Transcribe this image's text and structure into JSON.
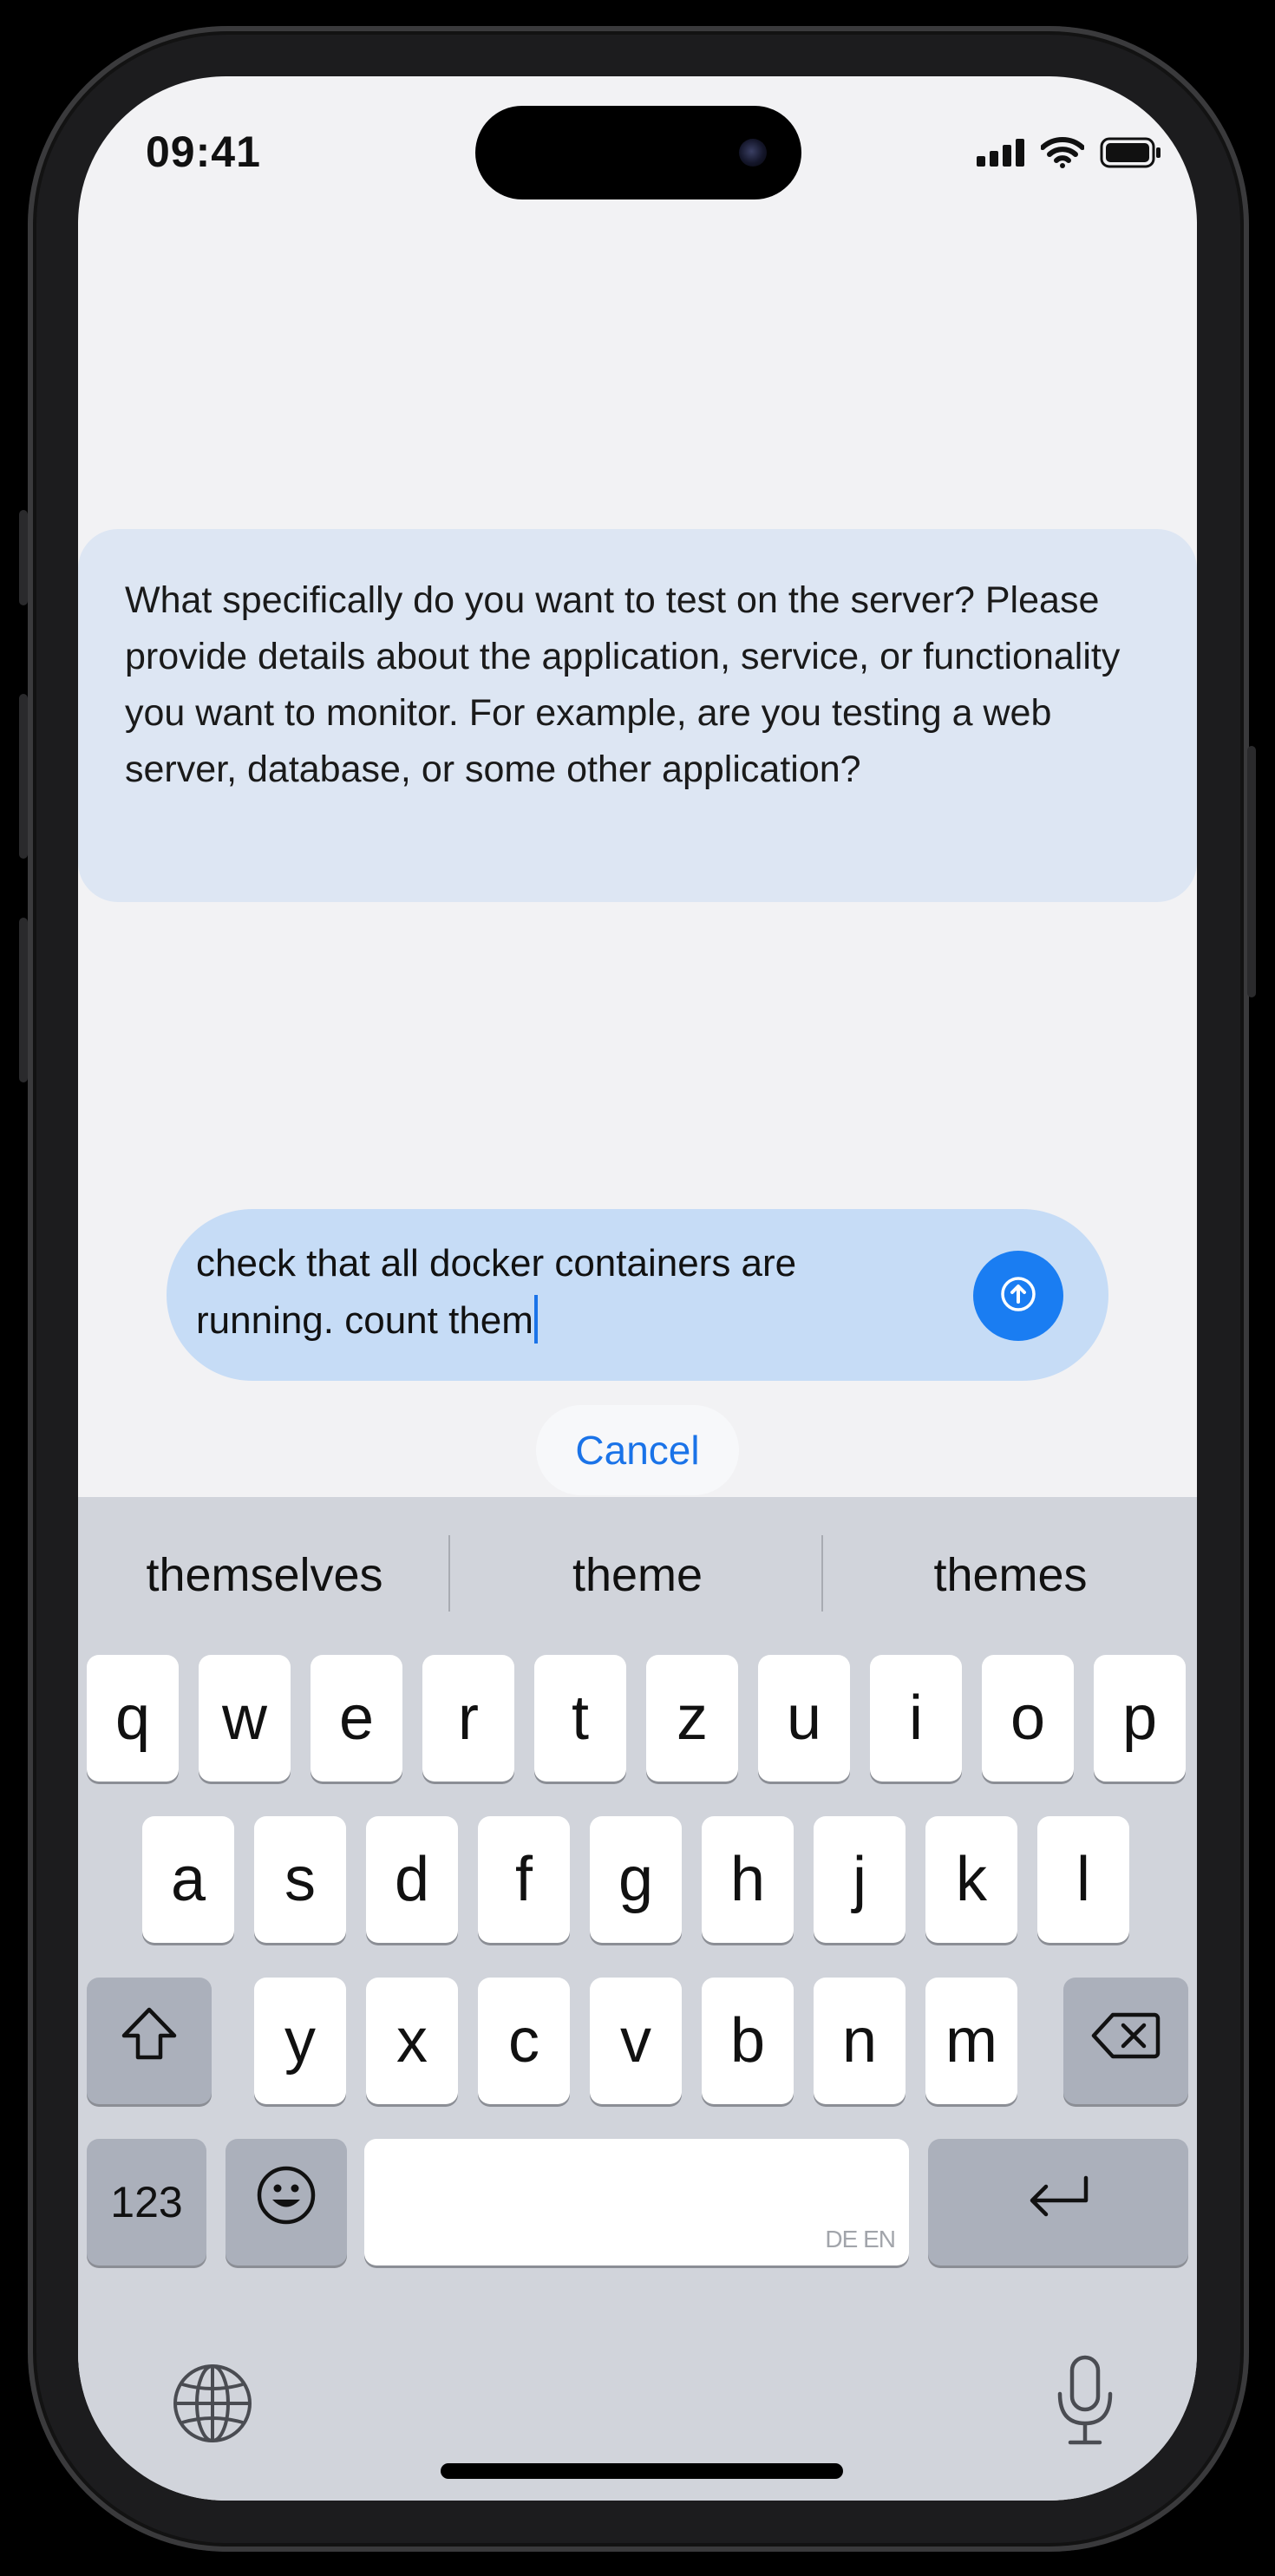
{
  "status_bar": {
    "time": "09:41"
  },
  "assistant_message": "What specifically do you want to test on the server? Please provide details about the application, service, or functionality you want to monitor. For example, are you testing a web server, database, or some other application?",
  "input": {
    "value": "check that all docker containers are running. count them"
  },
  "cancel_label": "Cancel",
  "suggestions": [
    "themselves",
    "theme",
    "themes"
  ],
  "keyboard": {
    "row1": [
      "q",
      "w",
      "e",
      "r",
      "t",
      "z",
      "u",
      "i",
      "o",
      "p"
    ],
    "row2": [
      "a",
      "s",
      "d",
      "f",
      "g",
      "h",
      "j",
      "k",
      "l"
    ],
    "row3": [
      "y",
      "x",
      "c",
      "v",
      "b",
      "n",
      "m"
    ],
    "numbers_label": "123",
    "space_lang": "DE EN"
  },
  "icons": [
    "wifi-icon",
    "cellular-icon",
    "battery-icon",
    "send-arrow-icon",
    "shift-icon",
    "backspace-icon",
    "emoji-icon",
    "return-icon",
    "globe-icon",
    "microphone-icon"
  ],
  "colors": {
    "accent": "#1a7df2",
    "bubble": "#dde6f3",
    "input": "#c6dcf6",
    "keyboard": "#d1d4db"
  }
}
